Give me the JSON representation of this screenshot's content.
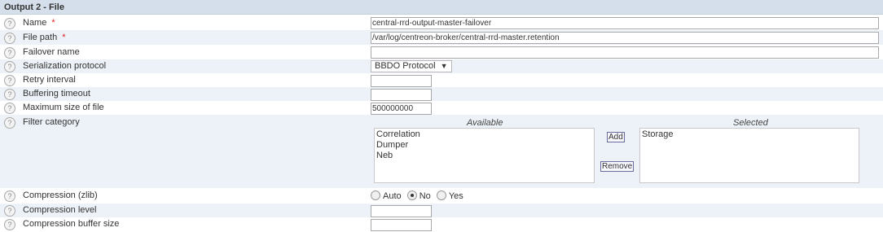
{
  "section": {
    "title": "Output 2 - File"
  },
  "help_glyph": "?",
  "required_mark": "*",
  "fields": {
    "name": {
      "label": "Name",
      "value": "central-rrd-output-master-failover"
    },
    "file_path": {
      "label": "File path",
      "value": "/var/log/centreon-broker/central-rrd-master.retention"
    },
    "failover_name": {
      "label": "Failover name",
      "value": ""
    },
    "serialization": {
      "label": "Serialization protocol",
      "selected": "BBDO Protocol"
    },
    "retry_interval": {
      "label": "Retry interval",
      "value": ""
    },
    "buffering_timeout": {
      "label": "Buffering timeout",
      "value": ""
    },
    "max_file_size": {
      "label": "Maximum size of file",
      "value": "500000000"
    },
    "filter_category": {
      "label": "Filter category",
      "available_title": "Available",
      "selected_title": "Selected",
      "available": [
        "Correlation",
        "Dumper",
        "Neb"
      ],
      "selected": [
        "Storage"
      ],
      "add_label": "Add",
      "remove_label": "Remove"
    },
    "compression": {
      "label": "Compression (zlib)",
      "options": [
        "Auto",
        "No",
        "Yes"
      ],
      "checked": "No"
    },
    "compression_level": {
      "label": "Compression level",
      "value": ""
    },
    "compression_buffer": {
      "label": "Compression buffer size",
      "value": ""
    }
  }
}
